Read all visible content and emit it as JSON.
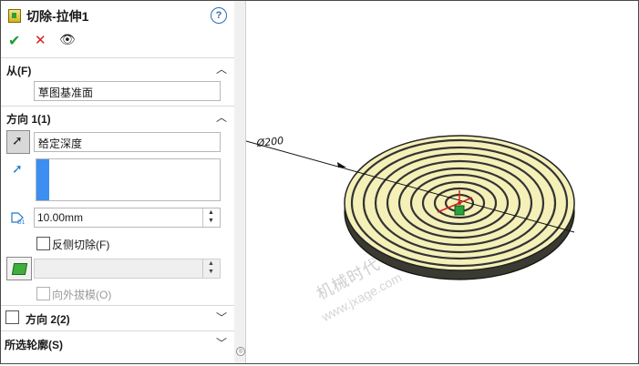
{
  "header": {
    "title": "切除-拉伸1",
    "help_glyph": "?"
  },
  "actions": {
    "ok_glyph": "✔",
    "cancel_glyph": "✕",
    "preview_glyph": "👁"
  },
  "from_section": {
    "label": "从(F)",
    "selected": "草图基准面"
  },
  "direction1": {
    "label": "方向 1(1)",
    "end_condition": "给定深度",
    "depth_value": "10.00mm",
    "flip_side_label": "反侧切除(F)",
    "draft_label": "向外拔模(O)"
  },
  "direction2": {
    "label": "方向 2(2)"
  },
  "selected_contours": {
    "label": "所选轮廓(S)"
  },
  "viewport": {
    "diameter_label": "Ø200",
    "watermark_cn": "机械时代",
    "watermark_url": "www.jxage.com",
    "disc_color": "#f4f0b8",
    "groove_color": "#333333",
    "base_color": "#3a3a32"
  },
  "icons": {
    "feature": "extrude-cut-icon",
    "help": "help-icon",
    "ok": "check-icon",
    "cancel": "close-icon",
    "preview": "eye-icon",
    "collapse": "chevron-up-icon",
    "expand": "chevron-down-icon",
    "reverse_direction": "reverse-direction-icon",
    "direction_vector": "direction-arrow-icon",
    "depth": "dimension-icon",
    "draft": "draft-face-icon"
  }
}
